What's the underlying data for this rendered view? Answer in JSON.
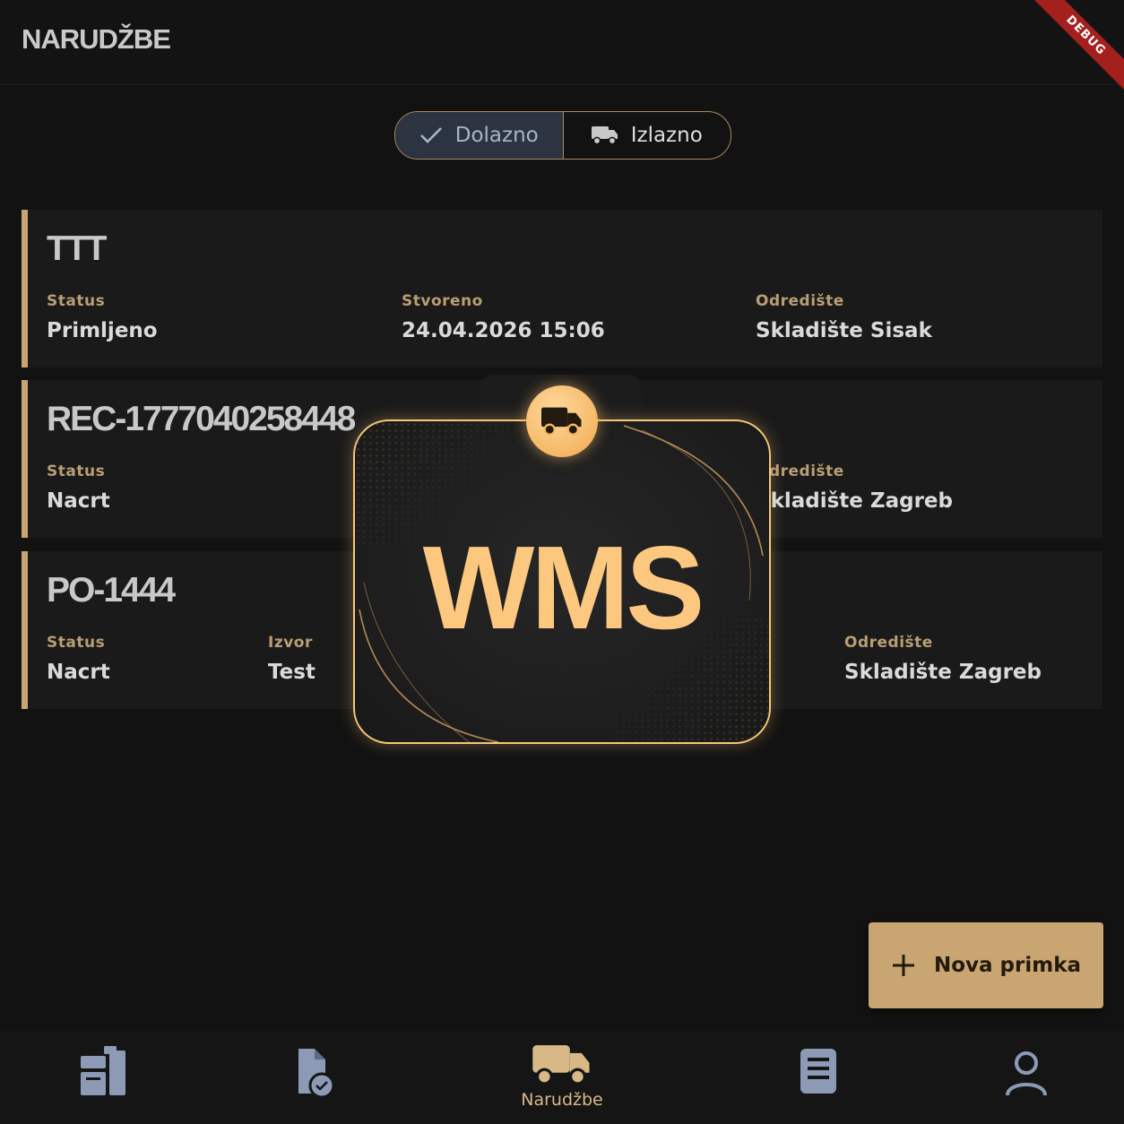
{
  "appbar": {
    "title": "NARUDŽBE",
    "debug_banner": "DEBUG"
  },
  "toggle": {
    "incoming": {
      "label": "Dolazno",
      "icon": "check-icon",
      "selected": true
    },
    "outgoing": {
      "label": "Izlazno",
      "icon": "truck-icon",
      "selected": false
    }
  },
  "orders": [
    {
      "title": "TTT",
      "fields": [
        {
          "label": "Status",
          "value": "Primljeno"
        },
        {
          "label": "Stvoreno",
          "value": "24.04.2026 15:06"
        },
        {
          "label": "Odredište",
          "value": "Skladište Sisak"
        }
      ]
    },
    {
      "title": "REC-1777040258448",
      "fields": [
        {
          "label": "Status",
          "value": "Nacrt"
        },
        {
          "label": "Odredište",
          "value": "Skladište Zagreb"
        }
      ]
    },
    {
      "title": "PO-1444",
      "fields": [
        {
          "label": "Status",
          "value": "Nacrt"
        },
        {
          "label": "Izvor",
          "value": "Test"
        },
        {
          "label": "Odredište",
          "value": "Skladište Zagreb"
        }
      ]
    }
  ],
  "splash": {
    "text": "WMS",
    "icon": "truck-icon"
  },
  "fab": {
    "label": "Nova primka",
    "icon": "plus-icon"
  },
  "bottom_nav": [
    {
      "icon": "inventory-icon",
      "label": ""
    },
    {
      "icon": "document-check-icon",
      "label": ""
    },
    {
      "icon": "truck-icon",
      "label": "Narudžbe",
      "active": true
    },
    {
      "icon": "book-icon",
      "label": ""
    },
    {
      "icon": "user-icon",
      "label": ""
    }
  ],
  "colors": {
    "accent": "#c9a572",
    "splash_accent": "#fcc880",
    "background": "#121212",
    "card": "#1a1a1a",
    "debug": "#a3201d",
    "nav_icon": "#8d9ab6"
  }
}
